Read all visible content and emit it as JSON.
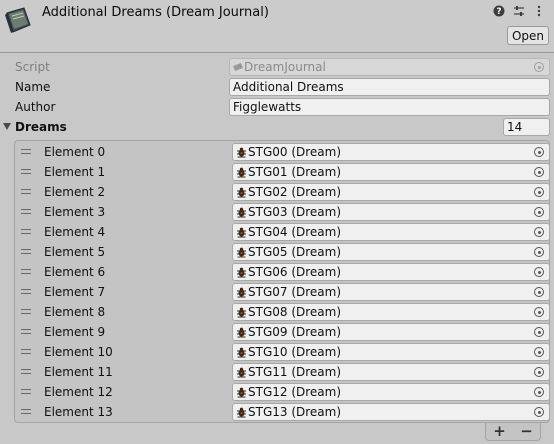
{
  "header": {
    "title": "Additional Dreams (Dream Journal)",
    "open_label": "Open",
    "icons": [
      "help-icon",
      "preset-icon",
      "more-options-icon"
    ]
  },
  "fields": {
    "script_label": "Script",
    "script_value": "DreamJournal",
    "name_label": "Name",
    "name_value": "Additional Dreams",
    "author_label": "Author",
    "author_value": "Figglewatts"
  },
  "dreams": {
    "label": "Dreams",
    "size": "14",
    "elements": [
      {
        "label": "Element 0",
        "value": "STG00 (Dream)"
      },
      {
        "label": "Element 1",
        "value": "STG01 (Dream)"
      },
      {
        "label": "Element 2",
        "value": "STG02 (Dream)"
      },
      {
        "label": "Element 3",
        "value": "STG03 (Dream)"
      },
      {
        "label": "Element 4",
        "value": "STG04 (Dream)"
      },
      {
        "label": "Element 5",
        "value": "STG05 (Dream)"
      },
      {
        "label": "Element 6",
        "value": "STG06 (Dream)"
      },
      {
        "label": "Element 7",
        "value": "STG07 (Dream)"
      },
      {
        "label": "Element 8",
        "value": "STG08 (Dream)"
      },
      {
        "label": "Element 9",
        "value": "STG09 (Dream)"
      },
      {
        "label": "Element 10",
        "value": "STG10 (Dream)"
      },
      {
        "label": "Element 11",
        "value": "STG11 (Dream)"
      },
      {
        "label": "Element 12",
        "value": "STG12 (Dream)"
      },
      {
        "label": "Element 13",
        "value": "STG13 (Dream)"
      }
    ],
    "add_label": "+",
    "remove_label": "−"
  }
}
